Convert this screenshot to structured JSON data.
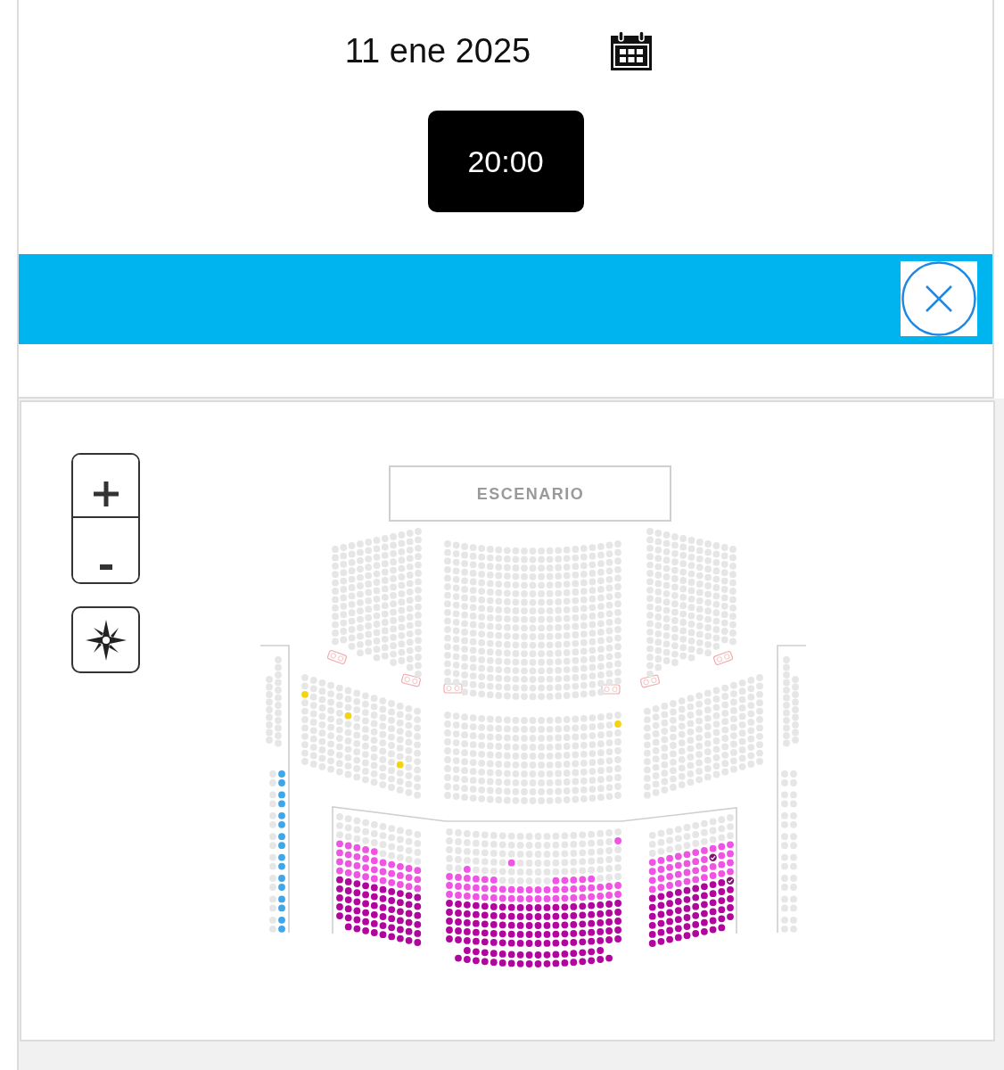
{
  "date_picker": {
    "value": "11 ene 2025"
  },
  "time_slots": [
    {
      "label": "20:00",
      "selected": true
    }
  ],
  "seat_map": {
    "stage_label": "ESCENARIO",
    "seat_groups": [
      {
        "color": "#e6e6e6",
        "selected": false
      },
      {
        "color": "#ee55e3",
        "selected": false
      },
      {
        "color": "#b1069e",
        "selected": false
      },
      {
        "color": "#f3d312",
        "selected": false
      },
      {
        "color": "#3fa6e9",
        "selected": false
      },
      {
        "color": "#7b1670",
        "selected": true
      }
    ]
  }
}
